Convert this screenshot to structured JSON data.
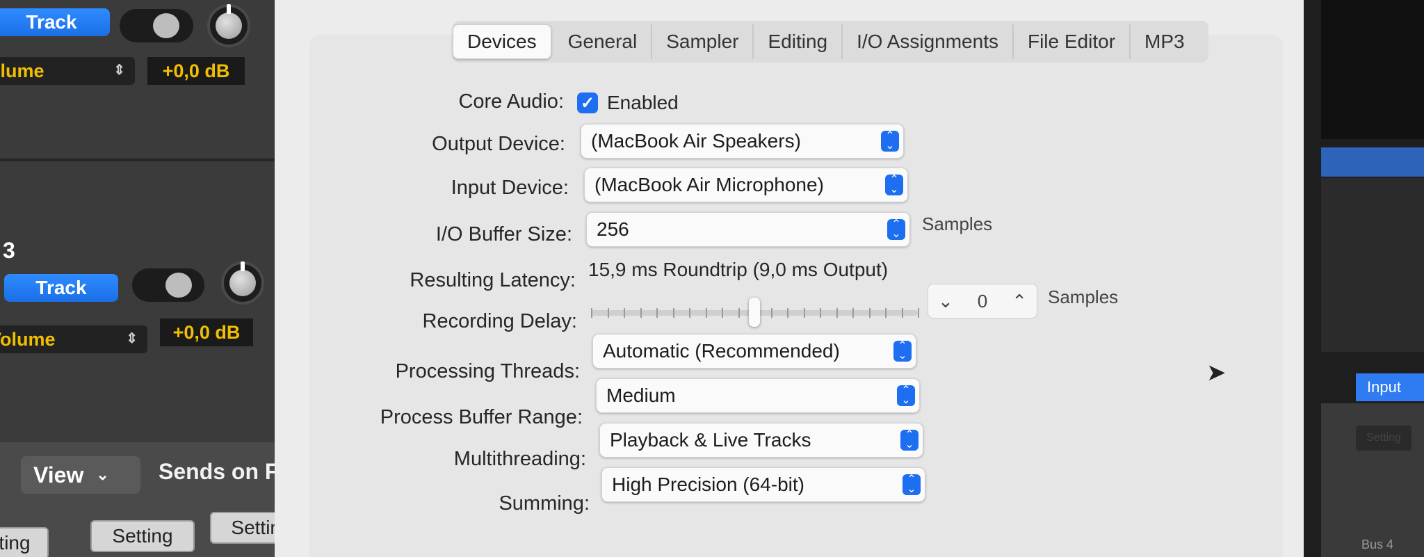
{
  "mixer": {
    "track_a": {
      "button_label": "Track",
      "volume_label": "Volume",
      "volume_value": "+0,0 dB"
    },
    "track_b": {
      "number": "3",
      "button_label": "Track",
      "volume_label": "Volume",
      "volume_value": "+0,0 dB"
    },
    "bottom": {
      "view_label": "View",
      "sends_label": "Sends on Fa",
      "setting_labels": [
        "Setting",
        "Setting",
        "Setting"
      ]
    }
  },
  "prefs": {
    "tabs": [
      "Devices",
      "General",
      "Sampler",
      "Editing",
      "I/O Assignments",
      "File Editor",
      "MP3"
    ],
    "active_tab": "Devices",
    "core_audio": {
      "label": "Core Audio:",
      "checkbox_label": "Enabled",
      "checked": true
    },
    "output_device": {
      "label": "Output Device:",
      "value": "(MacBook Air Speakers)"
    },
    "input_device": {
      "label": "Input Device:",
      "value": "(MacBook Air Microphone)"
    },
    "io_buffer": {
      "label": "I/O Buffer Size:",
      "value": "256",
      "units": "Samples"
    },
    "latency": {
      "label": "Resulting Latency:",
      "value": "15,9 ms Roundtrip (9,0 ms Output)"
    },
    "recording_delay": {
      "label": "Recording Delay:",
      "value": "0",
      "units": "Samples",
      "slider_fraction": 0.5
    },
    "processing_threads": {
      "label": "Processing Threads:",
      "value": "Automatic (Recommended)"
    },
    "process_buffer_range": {
      "label": "Process Buffer Range:",
      "value": "Medium"
    },
    "multithreading": {
      "label": "Multithreading:",
      "value": "Playback & Live Tracks"
    },
    "summing": {
      "label": "Summing:",
      "value": "High Precision (64-bit)"
    }
  },
  "right_panel": {
    "input_tab": "Input",
    "setting_label": "Setting",
    "bus_label": "Bus 4"
  },
  "colors": {
    "accent": "#1d6ef0",
    "track_button": "#2f8bff",
    "volume_text": "#f0c000"
  },
  "icons": {
    "checkbox": "checkmark-icon",
    "popup": "updown-chevron-icon",
    "stepper_down": "chevron-down-icon",
    "stepper_up": "chevron-up-icon",
    "cursor": "mouse-pointer-icon"
  }
}
